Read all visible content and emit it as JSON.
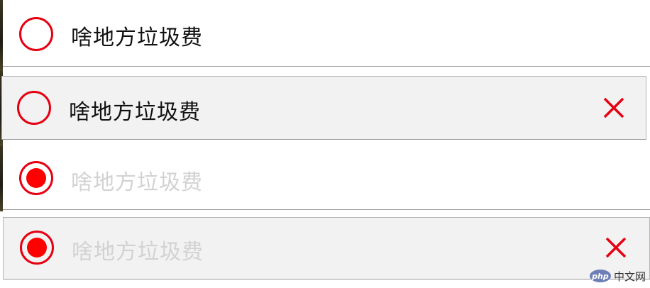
{
  "colors": {
    "accent_red": "#e60012",
    "checked_dot": "#ff0000",
    "done_text": "#d2d2d2",
    "hover_bg": "#f2f2f2"
  },
  "todos": [
    {
      "label": "啥地方垃圾费",
      "checked": false,
      "hovered": false,
      "delete_icon": "close-icon"
    },
    {
      "label": "啥地方垃圾费",
      "checked": false,
      "hovered": true,
      "delete_icon": "close-icon"
    },
    {
      "label": "啥地方垃圾费",
      "checked": true,
      "hovered": false,
      "delete_icon": "close-icon"
    },
    {
      "label": "啥地方垃圾费",
      "checked": true,
      "hovered": true,
      "delete_icon": "close-icon"
    }
  ],
  "watermark": {
    "logo_text": "php",
    "site_text": "中文网"
  }
}
